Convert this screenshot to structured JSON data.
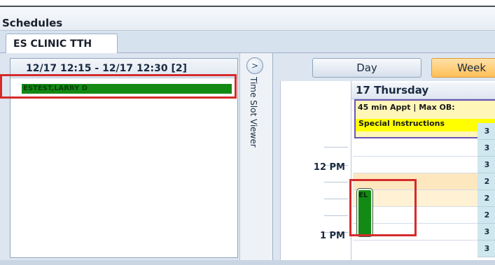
{
  "window": {
    "title": "Schedules"
  },
  "tabs": [
    {
      "label": "ES CLINIC TTH"
    }
  ],
  "time_slot": {
    "header": "12/17 12:15 - 12/17 12:30  [2]",
    "patients": [
      {
        "name": "ESTEST,LARRY D"
      }
    ],
    "viewer_label": "Time Slot Viewer",
    "expand_icon": ">"
  },
  "calendar": {
    "view_buttons": {
      "day": "Day",
      "week": "Week"
    },
    "day_header": "17 Thursday",
    "info": {
      "line1": "45 min Appt | Max OB:",
      "line2": "Special Instructions"
    },
    "time_labels": [
      "12 PM",
      "1 PM"
    ],
    "slot_counts": [
      "3",
      "3",
      "3",
      "2",
      "2",
      "2",
      "3",
      "3"
    ],
    "appointment_label": "EL"
  },
  "colors": {
    "highlight": "#d42b2b",
    "appointment": "#138a13",
    "week_button": "#ffbf57",
    "special_instructions": "#ffff00"
  }
}
